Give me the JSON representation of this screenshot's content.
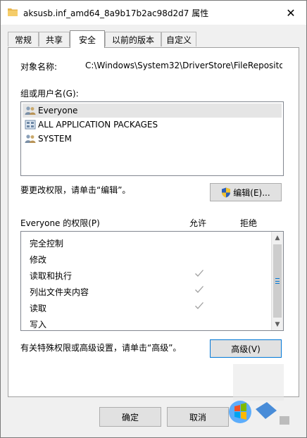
{
  "window": {
    "title": "aksusb.inf_amd64_8a9b17b2ac98d2d7 属性",
    "close_glyph": "✕"
  },
  "tabs": [
    {
      "label": "常规"
    },
    {
      "label": "共享"
    },
    {
      "label": "安全",
      "active": true
    },
    {
      "label": "以前的版本"
    },
    {
      "label": "自定义"
    }
  ],
  "security": {
    "object_name_label": "对象名称:",
    "object_name_value": "C:\\Windows\\System32\\DriverStore\\FileRepositor",
    "group_label": "组或用户名(G):",
    "users": [
      {
        "name": "Everyone",
        "icon": "users-icon",
        "selected": true
      },
      {
        "name": "ALL APPLICATION PACKAGES",
        "icon": "packages-icon"
      },
      {
        "name": "SYSTEM",
        "icon": "users-icon"
      }
    ],
    "change_hint": "要更改权限，请单击“编辑”。",
    "edit_button": "编辑(E)...",
    "perm_header": "Everyone 的权限(P)",
    "allow_header": "允许",
    "deny_header": "拒绝",
    "permissions": [
      {
        "name": "完全控制",
        "allow": false
      },
      {
        "name": "修改",
        "allow": false
      },
      {
        "name": "读取和执行",
        "allow": true
      },
      {
        "name": "列出文件夹内容",
        "allow": true
      },
      {
        "name": "读取",
        "allow": true
      },
      {
        "name": "写入",
        "allow": false
      }
    ],
    "advanced_hint": "有关特殊权限或高级设置，请单击“高级”。",
    "advanced_button": "高级(V)"
  },
  "footer": {
    "ok_button": "确定",
    "cancel_button": "取消"
  },
  "colors": {
    "accent": "#0078d7",
    "check": "#a0a0a0"
  }
}
